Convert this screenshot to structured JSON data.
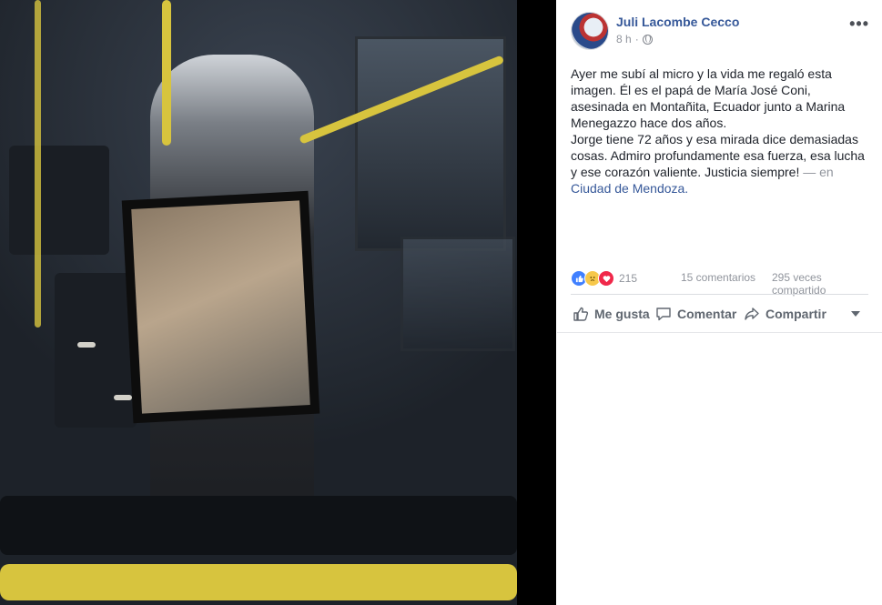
{
  "post": {
    "author": "Juli Lacombe Cecco",
    "time": "8 h",
    "separator": "·",
    "paragraphs": [
      "Ayer me subí al micro y la vida me regaló esta imagen. Él es el papá de María José Coni, asesinada en Montañita, Ecuador junto a Marina Menegazzo hace dos años.",
      "Jorge tiene 72 años y esa mirada dice demasiadas cosas. Admiro profundamente esa fuerza, esa lucha y ese corazón valiente. Justicia siempre!"
    ],
    "location_prefix": "— en",
    "location": "Ciudad de Mendoza."
  },
  "stats": {
    "reactions_count": "215",
    "comments": "15 comentarios",
    "shares": "295 veces compartido"
  },
  "actions": {
    "like": "Me gusta",
    "comment": "Comentar",
    "share": "Compartir"
  },
  "icons": {
    "globe": "globe-icon",
    "more": "more-options-icon",
    "like": "thumbs-up-icon",
    "comment": "speech-bubble-icon",
    "share": "share-arrow-icon",
    "caret": "caret-down-icon"
  },
  "colors": {
    "link": "#365899",
    "text": "#1d2129",
    "muted": "#90949c",
    "like_reaction": "#4080ff",
    "love_reaction": "#f0284a",
    "sad_reaction": "#f7c84a"
  }
}
